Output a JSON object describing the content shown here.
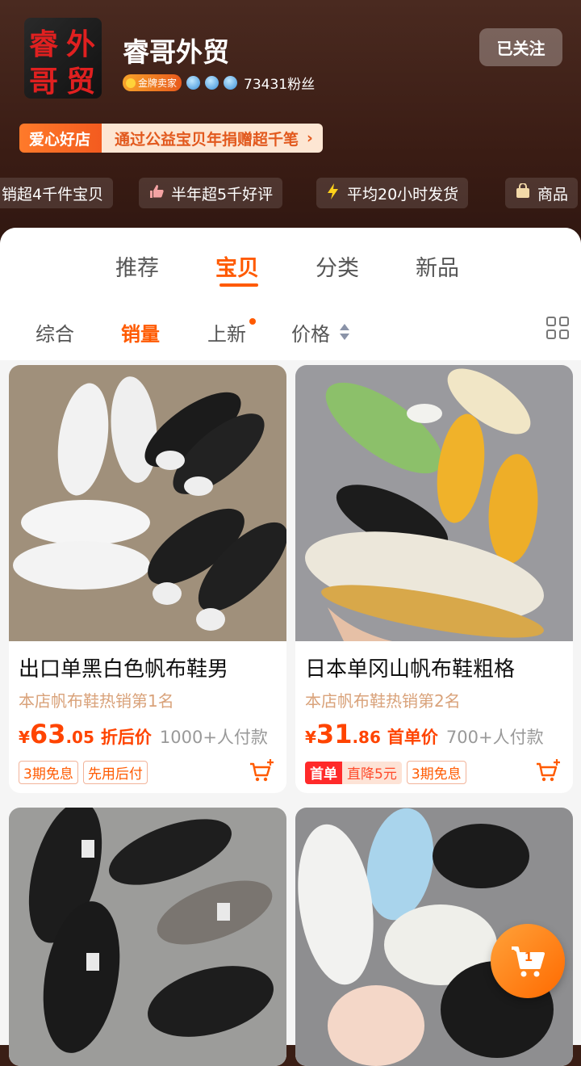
{
  "shop": {
    "logo_chars": [
      "睿",
      "外",
      "哥",
      "贸"
    ],
    "name": "睿哥外贸",
    "gold_badge": "金牌卖家",
    "fans": "73431粉丝",
    "follow_label": "已关注",
    "crown_count_icons": [
      "crown-icon",
      "crown-icon",
      "crown-icon"
    ]
  },
  "charity": {
    "tag": "爱心好店",
    "desc": "通过公益宝贝年捐赠超千笔",
    "arrow": "›"
  },
  "pills": [
    {
      "label": "销超4千件宝贝",
      "icon": ""
    },
    {
      "label": "半年超5千好评",
      "icon": "thumbs-up-icon"
    },
    {
      "label": "平均20小时发货",
      "icon": "lightning-icon"
    },
    {
      "label": "商品",
      "icon": "bag-icon"
    }
  ],
  "tabs": [
    {
      "label": "推荐",
      "active": false
    },
    {
      "label": "宝贝",
      "active": true
    },
    {
      "label": "分类",
      "active": false
    },
    {
      "label": "新品",
      "active": false
    }
  ],
  "sort": {
    "options": [
      "综合",
      "销量",
      "上新",
      "价格"
    ],
    "active": "销量"
  },
  "products": [
    {
      "title": "出口单黑白色帆布鞋男",
      "rank": "本店帆布鞋热销第1名",
      "price_symbol": "¥",
      "price_int": "63",
      "price_dec": ".05",
      "price_label": "折后价",
      "sold": "1000+人付款",
      "tags": [
        "3期免息",
        "先用后付"
      ]
    },
    {
      "title": "日本单冈山帆布鞋粗格",
      "rank": "本店帆布鞋热销第2名",
      "price_symbol": "¥",
      "price_int": "31",
      "price_dec": ".86",
      "price_label": "首单价",
      "sold": "700+人付款",
      "first_tag_a": "首单",
      "first_tag_b": "直降5元",
      "tags": [
        "3期免息"
      ]
    }
  ],
  "float_cart": {
    "count": "1"
  },
  "colors": {
    "accent": "#ff5a00",
    "header_bg": "#3a1c14"
  }
}
